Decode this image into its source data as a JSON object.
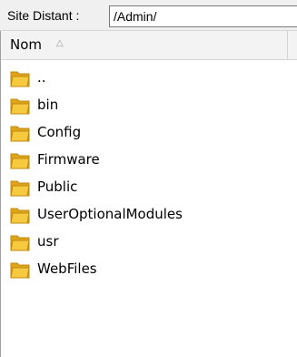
{
  "path_bar": {
    "label": "Site Distant :",
    "value": "/Admin/"
  },
  "columns": {
    "name": "Nom",
    "sort_indicator": "sort-ascending-icon"
  },
  "rows": [
    {
      "name": "..",
      "icon": "folder-icon"
    },
    {
      "name": "bin",
      "icon": "folder-icon"
    },
    {
      "name": "Config",
      "icon": "folder-icon"
    },
    {
      "name": "Firmware",
      "icon": "folder-icon"
    },
    {
      "name": "Public",
      "icon": "folder-icon"
    },
    {
      "name": "UserOptionalModules",
      "icon": "folder-icon"
    },
    {
      "name": "usr",
      "icon": "folder-icon"
    },
    {
      "name": "WebFiles",
      "icon": "folder-icon"
    }
  ],
  "colors": {
    "folder_back": "#e0a419",
    "folder_front": "#f6c93f",
    "folder_edge": "#c08a10"
  }
}
